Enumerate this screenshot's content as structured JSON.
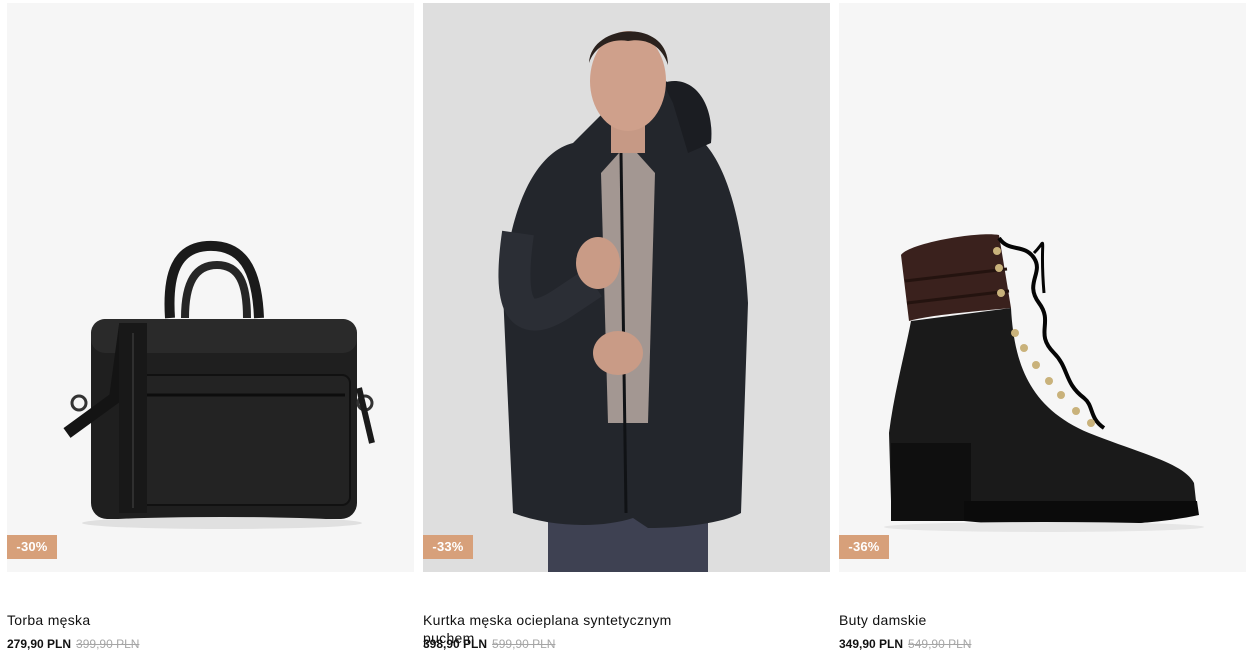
{
  "products": [
    {
      "name": "Torba męska",
      "price": "279,90 PLN",
      "old_price": "399,90 PLN",
      "discount": "-30%",
      "image": "black-laptop-bag-icon"
    },
    {
      "name": "Kurtka męska ocieplana syntetycznym puchem",
      "price": "398,90 PLN",
      "old_price": "599,90 PLN",
      "discount": "-33%",
      "image": "man-in-black-parka-photo"
    },
    {
      "name": "Buty damskie",
      "price": "349,90 PLN",
      "old_price": "549,90 PLN",
      "discount": "-36%",
      "image": "black-lace-up-boot-icon"
    }
  ],
  "colors": {
    "badge": "#d7a07a",
    "tile_background": "#f6f6f6",
    "old_price": "#a6a6a6"
  }
}
